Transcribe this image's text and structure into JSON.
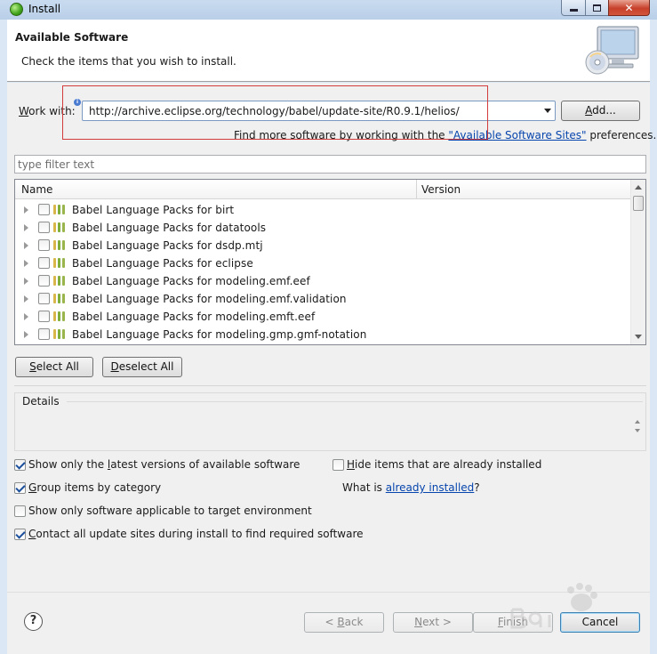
{
  "window": {
    "title": "Install",
    "close_glyph": "✕"
  },
  "banner": {
    "title": "Available Software",
    "description": "Check the items that you wish to install."
  },
  "work_with": {
    "label_first": "W",
    "label_rest": "ork with:",
    "value": "http://archive.eclipse.org/technology/babel/update-site/R0.9.1/helios/",
    "add_label_first": "A",
    "add_label_rest": "dd..."
  },
  "find_more": {
    "prefix": "Find more software by working with the ",
    "link": "\"Available Software Sites\"",
    "suffix": " preferences."
  },
  "filter": {
    "placeholder": "type filter text"
  },
  "table": {
    "columns": [
      "Name",
      "Version"
    ],
    "rows": [
      "Babel Language Packs for birt",
      "Babel Language Packs for datatools",
      "Babel Language Packs for dsdp.mtj",
      "Babel Language Packs for eclipse",
      "Babel Language Packs for modeling.emf.eef",
      "Babel Language Packs for modeling.emf.validation",
      "Babel Language Packs for modeling.emft.eef",
      "Babel Language Packs for modeling.gmp.gmf-notation"
    ]
  },
  "buttons": {
    "select_all_first": "S",
    "select_all_rest": "elect All",
    "deselect_all_first": "D",
    "deselect_all_rest": "eselect All",
    "back_pre": "< ",
    "back_first": "B",
    "back_rest": "ack",
    "next_first": "N",
    "next_rest": "ext >",
    "finish_first": "F",
    "finish_rest": "inish",
    "cancel": "Cancel",
    "help": "?"
  },
  "details": {
    "label": "Details"
  },
  "options": {
    "latest_pre": "Show only the ",
    "latest_ul": "l",
    "latest_rest": "atest versions of available software",
    "group_ul": "G",
    "group_rest": "roup items by category",
    "target": "Show only software applicable to target environment",
    "contact_ul": "C",
    "contact_rest": "ontact all update sites during install to find required software",
    "hide_ul": "H",
    "hide_rest": "ide items that are already installed",
    "what_is_prefix": "What is ",
    "what_is_link": "already installed",
    "what_is_suffix": "?"
  },
  "colors": {
    "link": "#0645ad",
    "annotation_box": "#d23c3c"
  }
}
